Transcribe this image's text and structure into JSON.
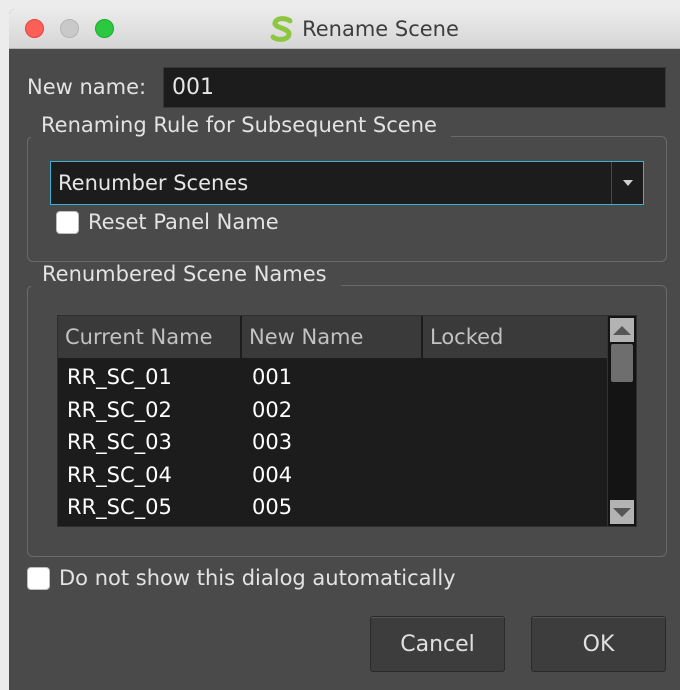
{
  "window": {
    "title": "Rename Scene",
    "app_icon": "storyboard-pro-logo-icon"
  },
  "form": {
    "new_name_label": "New name:",
    "new_name_value": "001"
  },
  "renaming_rule": {
    "group_title": "Renaming Rule for Subsequent Scene",
    "selected_option": "Renumber Scenes",
    "reset_panel_name_label": "Reset Panel Name",
    "reset_panel_name_checked": false
  },
  "renumbered": {
    "group_title": "Renumbered Scene Names",
    "columns": [
      "Current Name",
      "New Name",
      "Locked"
    ],
    "rows": [
      {
        "current": "RR_SC_01",
        "new": "001",
        "locked": ""
      },
      {
        "current": "RR_SC_02",
        "new": "002",
        "locked": ""
      },
      {
        "current": "RR_SC_03",
        "new": "003",
        "locked": ""
      },
      {
        "current": "RR_SC_04",
        "new": "004",
        "locked": ""
      },
      {
        "current": "RR_SC_05",
        "new": "005",
        "locked": ""
      }
    ]
  },
  "footer": {
    "dont_show_label": "Do not show this dialog automatically",
    "dont_show_checked": false,
    "cancel_label": "Cancel",
    "ok_label": "OK"
  },
  "colors": {
    "dialog_bg": "#4a4a4a",
    "field_bg": "#1c1c1c",
    "focus_accent": "#3cb0d2",
    "logo_green": "#8dc63f"
  }
}
